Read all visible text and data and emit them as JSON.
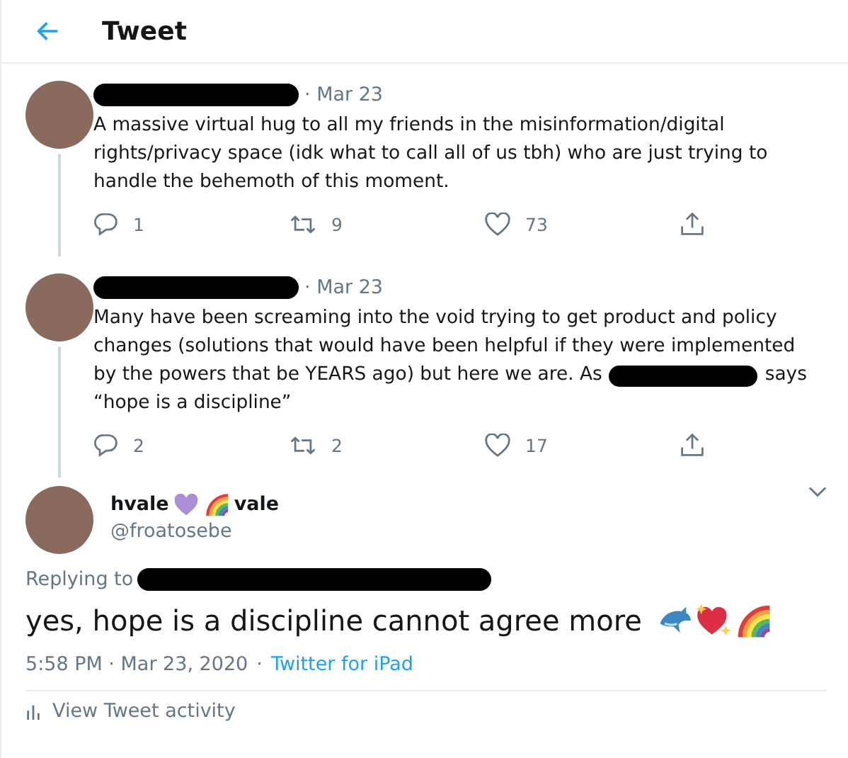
{
  "header": {
    "title": "Tweet"
  },
  "thread": [
    {
      "date": "· Mar 23",
      "lines": [
        [
          {
            "kind": "text",
            "value": "A massive virtual hug to all my friends in the misinformation/digital"
          }
        ],
        [
          {
            "kind": "text",
            "value": "rights/privacy space (idk what to call all of us tbh) who are just trying to"
          }
        ],
        [
          {
            "kind": "text",
            "value": "handle the behemoth of this moment."
          }
        ]
      ],
      "actions": [
        {
          "kind": "reply",
          "count": "1"
        },
        {
          "kind": "retweet",
          "count": "9"
        },
        {
          "kind": "like",
          "count": "73"
        },
        {
          "kind": "share"
        }
      ]
    },
    {
      "date": "· Mar 23",
      "lines": [
        [
          {
            "kind": "text",
            "value": "Many have been screaming into the void trying to get product and policy"
          }
        ],
        [
          {
            "kind": "text",
            "value": "changes (solutions that would have been helpful if they were implemented"
          }
        ],
        [
          {
            "kind": "text",
            "value": "by the powers that be YEARS ago) but here we are. As"
          },
          {
            "kind": "redaction"
          },
          {
            "kind": "text",
            "value": "says"
          }
        ],
        [
          {
            "kind": "text",
            "value": "“hope is a discipline”"
          }
        ]
      ],
      "actions": [
        {
          "kind": "reply",
          "count": "2"
        },
        {
          "kind": "retweet",
          "count": "2"
        },
        {
          "kind": "like",
          "count": "17"
        },
        {
          "kind": "share"
        }
      ]
    }
  ],
  "main_tweet": {
    "name_parts": [
      "hvale",
      "vale"
    ],
    "handle": "@froatosebe",
    "replying_to": "Replying to",
    "text": "yes, hope is a discipline cannot agree more",
    "timestamp": "5:58 PM · Mar 23, 2020",
    "separator": "·",
    "source": "Twitter for iPad"
  },
  "activity": "View Tweet activity"
}
